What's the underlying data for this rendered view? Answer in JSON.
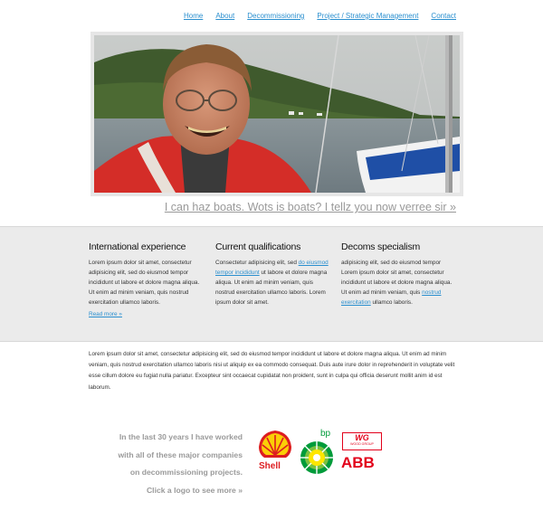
{
  "nav": {
    "items": [
      {
        "label": "Home"
      },
      {
        "label": "About"
      },
      {
        "label": "Decommissioning"
      },
      {
        "label": "Project / Strategic Management"
      },
      {
        "label": "Contact"
      }
    ]
  },
  "hero": {
    "caption": "I can haz boats. Wots is boats? I tellz you now verree sir »"
  },
  "features": {
    "col1": {
      "title": "International experience",
      "text": "Lorem ipsum dolor sit amet, consectetur adipisicing elit, sed do eiusmod tempor incididunt ut labore et dolore magna aliqua. Ut enim ad minim veniam, quis nostrud exercitation ullamco laboris.",
      "readmore": "Read more »"
    },
    "col2": {
      "title": "Current qualifications",
      "text_before": "Consectetur adipisicing elit, sed ",
      "link": "do eiusmod tempor incididunt",
      "text_after": " ut labore et dolore magna aliqua. Ut enim ad minim veniam, quis nostrud exercitation ullamco laboris. Lorem ipsum dolor sit amet."
    },
    "col3": {
      "title": "Decoms specialism",
      "text_before": "adipisicing elit, sed do eiusmod tempor Lorem ipsum dolor sit amet, consectetur incididunt ut labore et dolore magna aliqua. Ut enim ad minim veniam, quis ",
      "link": "nostrud exercitation",
      "text_after": " ullamco laboris."
    }
  },
  "body_text": "Lorem ipsum dolor sit amet, consectetur adipisicing elit, sed do eiusmod tempor incididunt ut labore et dolore magna aliqua. Ut enim ad minim veniam, quis nostrud exercitation ullamco laboris nisi ut aliquip ex ea commodo consequat. Duis aute irure dolor in reprehenderit in voluptate velit esse cillum dolore eu fugiat nulla pariatur. Excepteur sint occaecat cupidatat non proident, sunt in culpa qui officia deserunt mollit anim id est laborum.",
  "companies": {
    "lines": [
      "In the last 30 years I have worked",
      "with all of these major companies",
      "on decommissioning projects.",
      "Click a logo to see more »"
    ],
    "logos": {
      "shell": {
        "text": "Shell",
        "icon": "shell-logo"
      },
      "bp": {
        "text": "bp",
        "icon": "bp-helios-logo"
      },
      "wood_group": {
        "text": "WG",
        "subtext": "WOOD GROUP",
        "icon": "wood-group-logo"
      },
      "abb": {
        "text": "ABB",
        "icon": "abb-logo"
      }
    }
  },
  "colors": {
    "link": "#2a8fcf",
    "band": "#ebebeb",
    "muted_text": "#9a9a9a",
    "shell_red": "#dd1d21",
    "shell_yellow": "#fbce07",
    "bp_green": "#009b3a",
    "abb_red": "#e2001a"
  }
}
